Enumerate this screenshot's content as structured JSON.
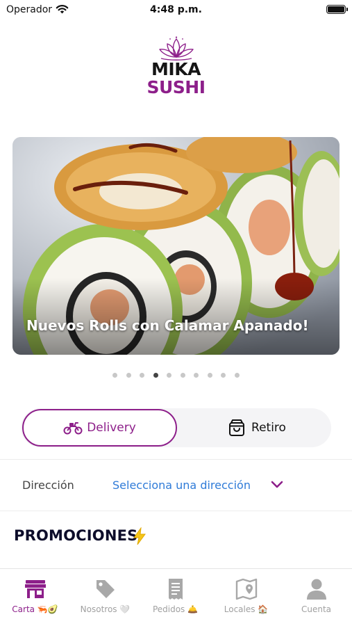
{
  "status_bar": {
    "carrier": "Operador",
    "time": "4:48 p.m."
  },
  "logo": {
    "line1": "MIKA",
    "line2": "SUSHI"
  },
  "banner": {
    "caption": "Nuevos Rolls con Calamar Apanado!",
    "page_count": 10,
    "active_page": 4
  },
  "order_mode": {
    "delivery_label": "Delivery",
    "pickup_label": "Retiro",
    "selected": "Delivery"
  },
  "address": {
    "label": "Dirección",
    "placeholder": "Selecciona una dirección"
  },
  "promotions": {
    "title": "PROMOCIONES",
    "emoji": "⚡"
  },
  "tabbar": {
    "tabs": [
      {
        "label": "Carta 🦐🥑",
        "icon": "store-icon",
        "active": true
      },
      {
        "label": "Nosotros 🤍",
        "icon": "tag-icon",
        "active": false
      },
      {
        "label": "Pedidos 🛎️",
        "icon": "receipt-icon",
        "active": false
      },
      {
        "label": "Locales 🏠",
        "icon": "map-icon",
        "active": false
      },
      {
        "label": "Cuenta",
        "icon": "user-icon",
        "active": false
      }
    ]
  },
  "colors": {
    "brand": "#8d1f8a",
    "link": "#2f7bd8",
    "inactive": "#a0a0a0",
    "title": "#0d0d2a"
  }
}
